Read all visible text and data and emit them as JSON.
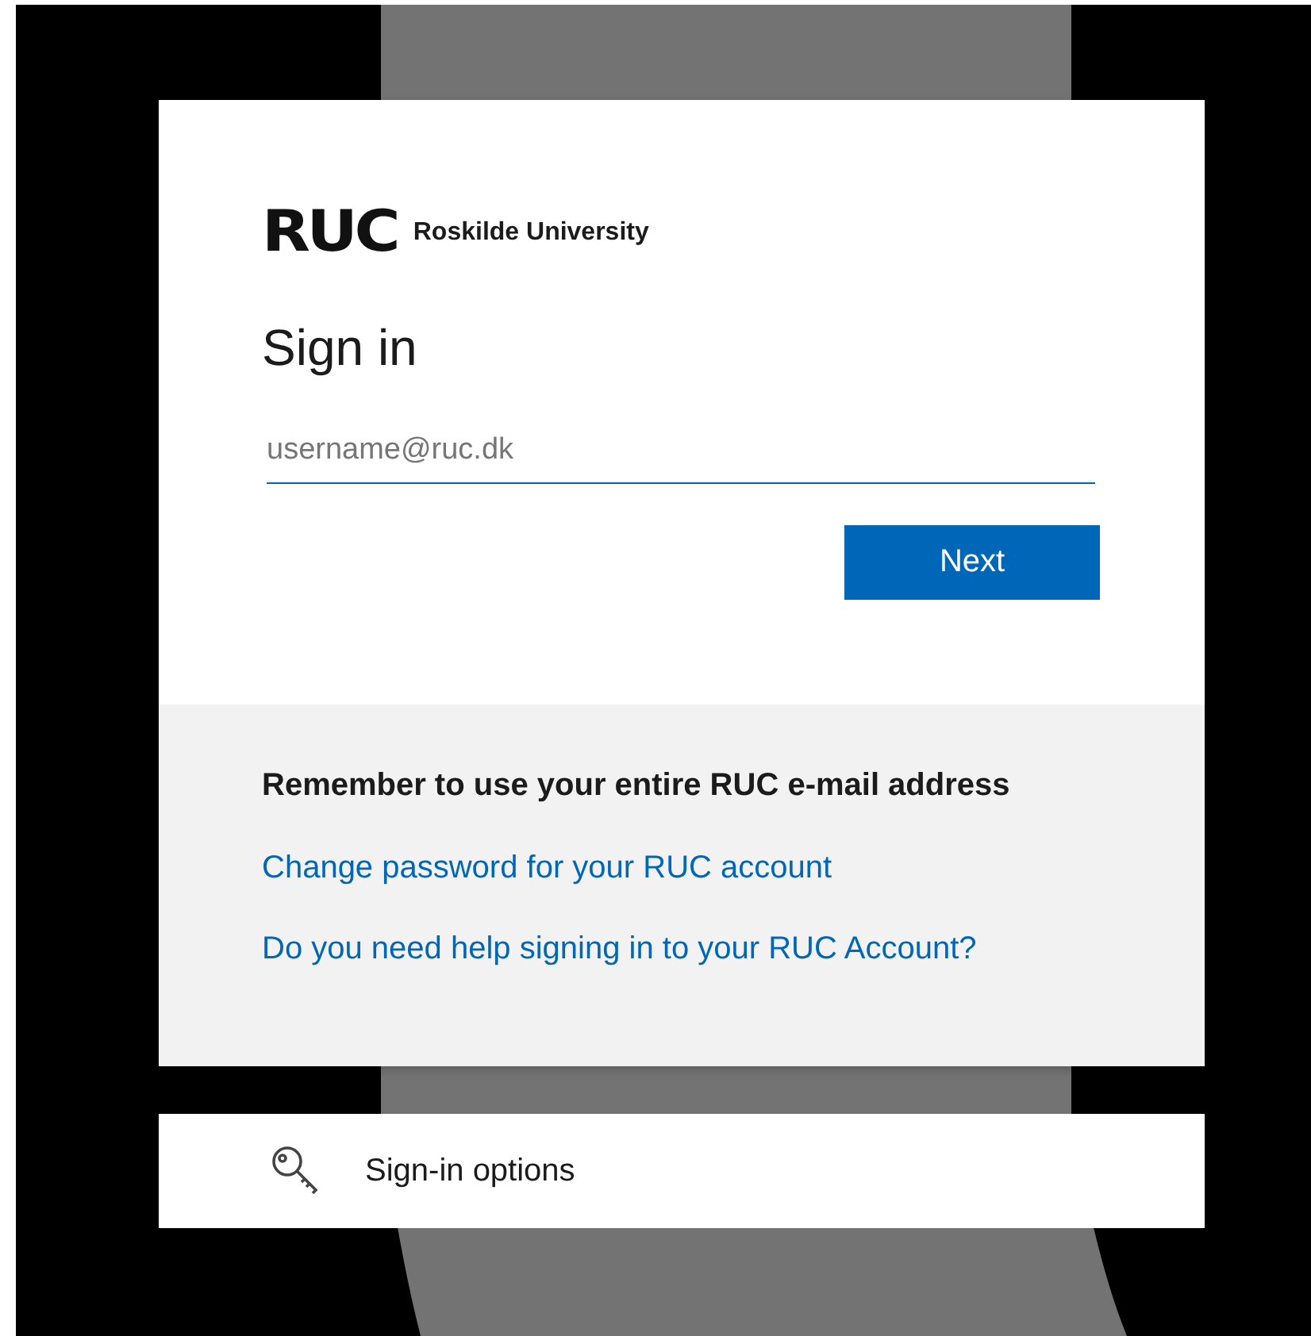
{
  "logo": {
    "mark": "RUC",
    "name": "Roskilde University"
  },
  "title": "Sign in",
  "username_field": {
    "placeholder": "username@ruc.dk"
  },
  "next_button": "Next",
  "info": {
    "note": "Remember to use your entire RUC e-mail address",
    "links": [
      "Change password for your RUC account",
      "Do you need help signing in to your RUC Account?"
    ]
  },
  "sign_in_options": "Sign-in options"
}
